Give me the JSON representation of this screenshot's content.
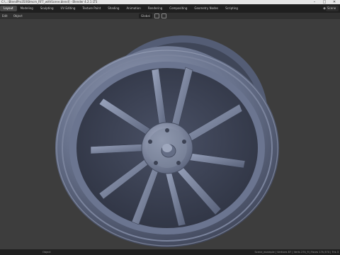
{
  "window": {
    "title": "C:\\...\\BlendPro350\\Bmcm_RF7_withScene.blend] - Blender 4.2.1 LTS",
    "buttons": [
      "–",
      "□",
      "✕"
    ]
  },
  "topbar": {
    "workspaces": [
      "Layout",
      "Modeling",
      "Sculpting",
      "UV Editing",
      "Texture Paint",
      "Shading",
      "Animation",
      "Rendering",
      "Compositing",
      "Geometry Nodes",
      "Scripting"
    ],
    "active_workspace": "Layout",
    "scene_label": "Scene"
  },
  "subheader": {
    "left_items": [
      "Edit",
      "Object"
    ],
    "orientation": "Global"
  },
  "statusbar": {
    "left": "",
    "middle": "Object",
    "right": "Scene_example | Vertices 87 | Verts 27k_9 | Faces 17k,574 | Tris 3"
  },
  "colors": {
    "viewport_bg": "#3d3d3d",
    "wheel_base": "#5c6680",
    "wheel_light": "#8e98b2",
    "wheel_dark": "#353b4c"
  },
  "icons": [
    "blender-logo-icon",
    "minimize-icon",
    "maximize-icon",
    "close-icon",
    "scene-icon",
    "snap-icon",
    "proportional-icon"
  ]
}
